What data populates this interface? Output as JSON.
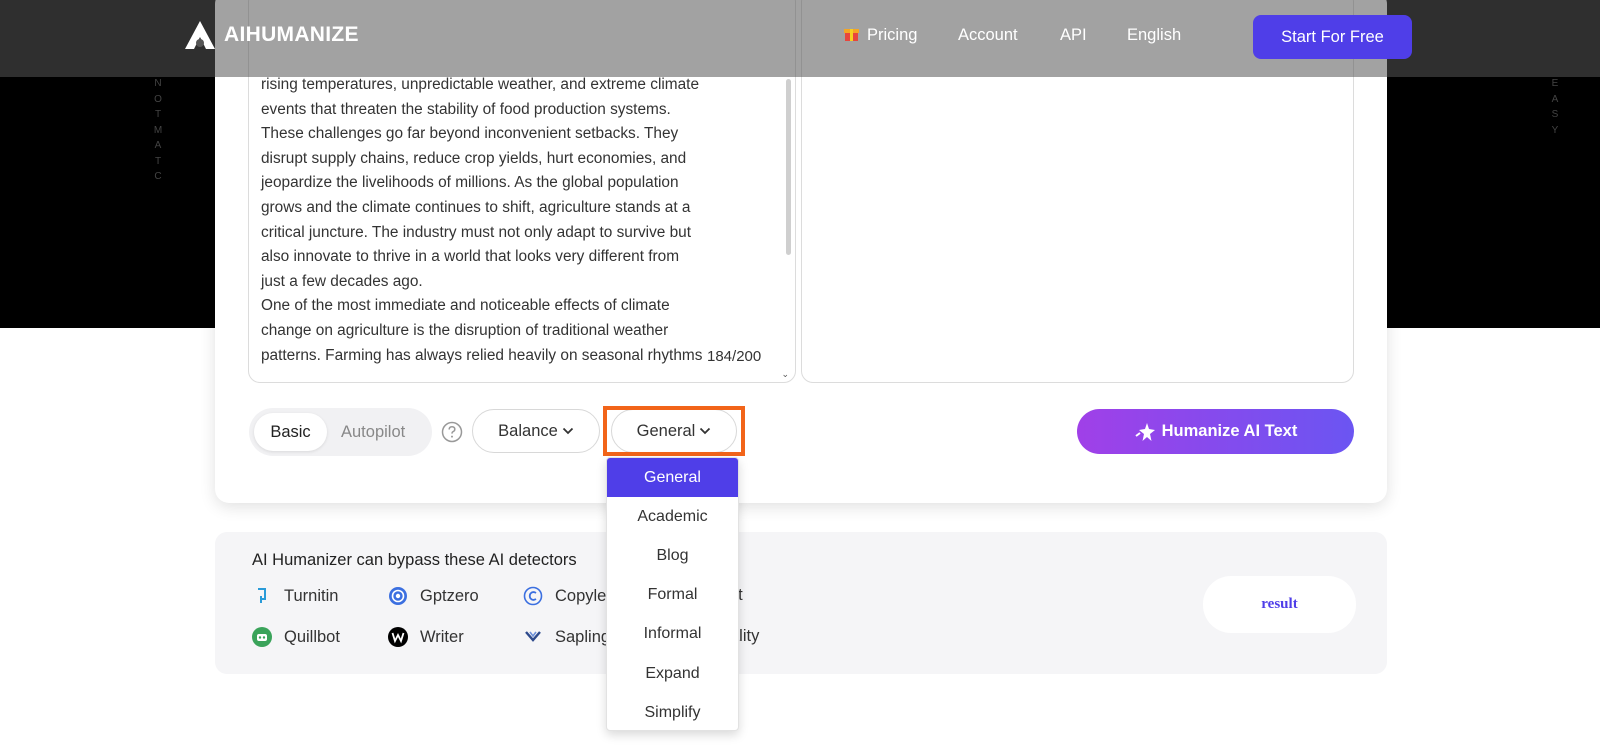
{
  "header": {
    "logo_text": "AIHUMANIZE",
    "nav": {
      "pricing": "Pricing",
      "account": "Account",
      "api": "API",
      "language": "English"
    },
    "start_button": "Start For Free"
  },
  "hero": {
    "left_side_letters": [
      "N",
      "O",
      "T",
      "M",
      "A",
      "T",
      "C"
    ],
    "right_side_letters": [
      "E",
      "A",
      "S",
      "Y"
    ]
  },
  "editor": {
    "input_text": "rising temperatures, unpredictable weather, and extreme climate\nevents that threaten the stability of food production systems.\nThese challenges go far beyond inconvenient setbacks. They\ndisrupt supply chains, reduce crop yields, hurt economies, and\njeopardize the livelihoods of millions. As the global population\ngrows and the climate continues to shift, agriculture stands at a\ncritical juncture. The industry must not only adapt to survive but\nalso innovate to thrive in a world that looks very different from\njust a few decades ago.\nOne of the most immediate and noticeable effects of climate\nchange on agriculture is the disruption of traditional weather\npatterns. Farming has always relied heavily on seasonal rhythms",
    "word_count": "184/200"
  },
  "controls": {
    "mode_basic": "Basic",
    "mode_autopilot": "Autopilot",
    "strength_select": "Balance",
    "purpose_select": "General",
    "humanize_button": "Humanize AI Text"
  },
  "dropdown": {
    "options": [
      "General",
      "Academic",
      "Blog",
      "Formal",
      "Informal",
      "Expand",
      "Simplify"
    ],
    "selected": "General"
  },
  "detectors": {
    "title": "AI Humanizer can bypass these AI detectors",
    "row1": [
      {
        "name": "Turnitin",
        "icon": "turnitin-icon"
      },
      {
        "name": "Gptzero",
        "icon": "gptzero-icon"
      },
      {
        "name": "Copyle",
        "icon": "copyleaks-icon"
      },
      {
        "name": "ot",
        "icon": ""
      }
    ],
    "row2": [
      {
        "name": "Quillbot",
        "icon": "quillbot-icon"
      },
      {
        "name": "Writer",
        "icon": "writer-icon"
      },
      {
        "name": "Sapling",
        "icon": "sapling-icon"
      },
      {
        "name": "ality",
        "icon": ""
      }
    ],
    "result_label": "result"
  },
  "colors": {
    "brand": "#4f3ee8",
    "highlight": "#f26419",
    "hero_bg": "#000000"
  }
}
